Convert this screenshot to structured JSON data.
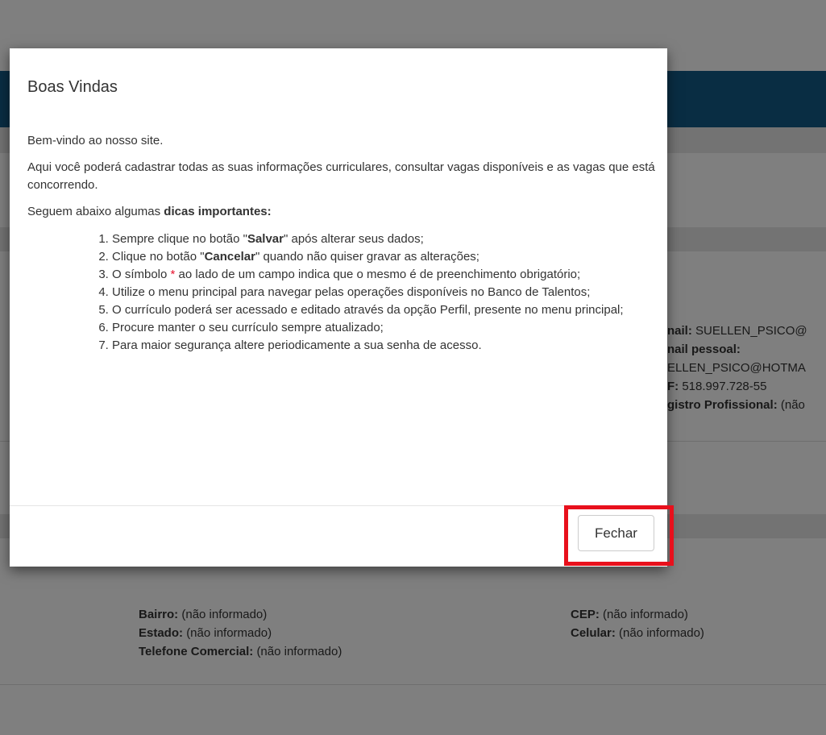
{
  "background": {
    "contact": {
      "email_label": "nail:",
      "email_value": "SUELLEN_PSICO@",
      "personal_email_label": "nail pessoal:",
      "personal_email_value": "ELLEN_PSICO@HOTMA",
      "cpf_label": "F:",
      "cpf_value": "518.997.728-55",
      "registro_label": "gistro Profissional:",
      "registro_value": "(não"
    },
    "address": {
      "bairro_label": "Bairro:",
      "bairro_value": "(não informado)",
      "estado_label": "Estado:",
      "estado_value": "(não informado)",
      "telefone_label": "Telefone Comercial:",
      "telefone_value": "(não informado)",
      "cep_label": "CEP:",
      "cep_value": "(não informado)",
      "celular_label": "Celular:",
      "celular_value": "(não informado)"
    }
  },
  "modal": {
    "title": "Boas Vindas",
    "welcome": "Bem-vindo ao nosso site.",
    "intro": "Aqui você poderá cadastrar todas as suas informações curriculares, consultar vagas disponíveis e as vagas que está concorrendo.",
    "tips_intro_prefix": "Seguem abaixo algumas ",
    "tips_intro_bold": "dicas importantes:",
    "tips": {
      "t1_prefix": "Sempre clique no botão \"",
      "t1_bold": "Salvar",
      "t1_suffix": "\" após alterar seus dados;",
      "t2_prefix": "Clique no botão \"",
      "t2_bold": "Cancelar",
      "t2_suffix": "\" quando não quiser gravar as alterações;",
      "t3_prefix": "O símbolo ",
      "t3_star": "*",
      "t3_suffix": " ao lado de um campo indica que o mesmo é de preenchimento obrigatório;",
      "t4": "Utilize o menu principal para navegar pelas operações disponíveis no Banco de Talentos;",
      "t5": "O currículo poderá ser acessado e editado através da opção Perfil, presente no menu principal;",
      "t6": "Procure manter o seu currículo sempre atualizado;",
      "t7": "Para maior segurança altere periodicamente a sua senha de acesso."
    },
    "close_label": "Fechar"
  },
  "colors": {
    "header_bar": "#135a86",
    "highlight": "#e8101c",
    "required_star": "#e8112d"
  }
}
